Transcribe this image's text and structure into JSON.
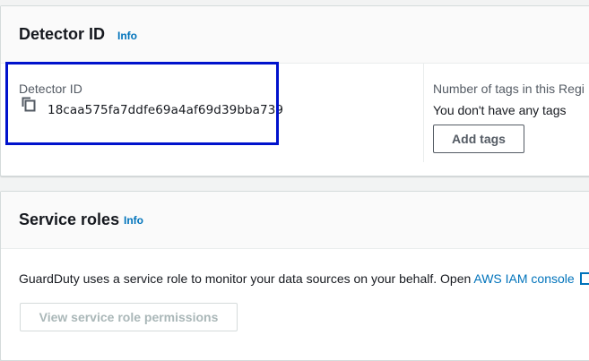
{
  "detector_panel": {
    "title": "Detector ID",
    "info": "Info",
    "detector_label": "Detector ID",
    "detector_id": "18caa575fa7ddfe69a4af69d39bba739",
    "tags_label": "Number of tags in this Regi",
    "tags_value": "You don't have any tags",
    "add_tags_button": "Add tags"
  },
  "roles_panel": {
    "title": "Service roles",
    "info": "Info",
    "description": "GuardDuty uses a service role to monitor your data sources on your behalf. Open ",
    "iam_link": "AWS IAM console",
    "view_button": "View service role permissions"
  },
  "colors": {
    "link": "#0073bb",
    "highlight": "#0012cc",
    "panel_header": "#fafafa",
    "background": "#f2f3f3"
  },
  "icons": {
    "copy": "copy-icon",
    "external": "external-link-icon"
  }
}
